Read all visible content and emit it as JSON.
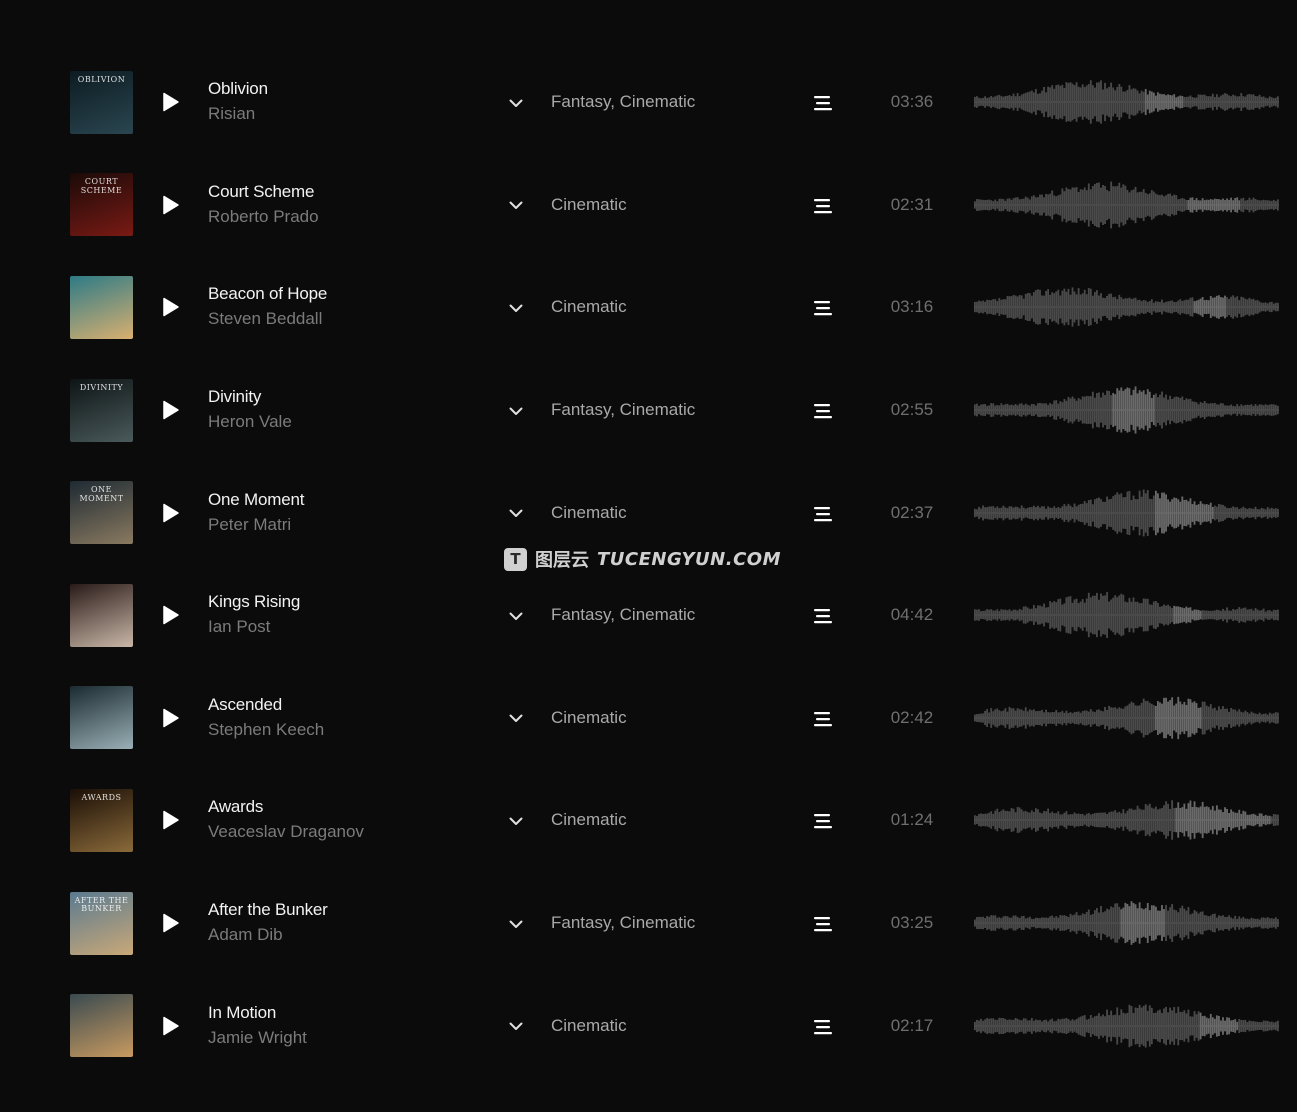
{
  "watermark": {
    "logo_letter": "T",
    "cn_text": "图层云",
    "en_text": "TUCENGYUN.COM"
  },
  "icons": {
    "play": "play-icon",
    "expand": "chevron-down-icon",
    "menu": "menu-lines-icon"
  },
  "colors": {
    "background": "#0b0b0b",
    "title": "#f2f2f2",
    "artist": "#7b7b7b",
    "genre": "#a9a9a9",
    "duration": "#6f6f6f",
    "waveform": "#4a4a4a",
    "waveform_played": "#6a6a6a"
  },
  "tracks": [
    {
      "title": "Oblivion",
      "artist": "Risian",
      "genres": "Fantasy, Cinematic",
      "duration": "03:36",
      "cover_text": "OBLIVION",
      "cover_colors": [
        "#0d1b22",
        "#2a4650"
      ],
      "seed": 11,
      "highlight": [
        0.56,
        0.68
      ]
    },
    {
      "title": "Court Scheme",
      "artist": "Roberto Prado",
      "genres": "Cinematic",
      "duration": "02:31",
      "cover_text": "COURT SCHEME",
      "cover_colors": [
        "#1a0a08",
        "#7a1a14"
      ],
      "seed": 23,
      "highlight": [
        0.7,
        0.87
      ]
    },
    {
      "title": "Beacon of Hope",
      "artist": "Steven Beddall",
      "genres": "Cinematic",
      "duration": "03:16",
      "cover_text": "",
      "cover_colors": [
        "#2d7a86",
        "#d9b070"
      ],
      "seed": 37,
      "highlight": [
        0.72,
        0.82
      ]
    },
    {
      "title": "Divinity",
      "artist": "Heron Vale",
      "genres": "Fantasy, Cinematic",
      "duration": "02:55",
      "cover_text": "DIVINITY",
      "cover_colors": [
        "#0e1416",
        "#4a5a5a"
      ],
      "seed": 41,
      "highlight": [
        0.45,
        0.59
      ]
    },
    {
      "title": "One Moment",
      "artist": "Peter Matri",
      "genres": "Cinematic",
      "duration": "02:37",
      "cover_text": "ONE MOMENT",
      "cover_colors": [
        "#1e2a33",
        "#8a7a60"
      ],
      "seed": 53,
      "highlight": [
        0.59,
        0.78
      ]
    },
    {
      "title": "Kings Rising",
      "artist": "Ian Post",
      "genres": "Fantasy, Cinematic",
      "duration": "04:42",
      "cover_text": "",
      "cover_colors": [
        "#2a1a18",
        "#c9b8a8"
      ],
      "seed": 67,
      "highlight": [
        0.65,
        0.74
      ]
    },
    {
      "title": "Ascended",
      "artist": "Stephen Keech",
      "genres": "Cinematic",
      "duration": "02:42",
      "cover_text": "",
      "cover_colors": [
        "#1a2a30",
        "#9ab0b6"
      ],
      "seed": 71,
      "highlight": [
        0.59,
        0.74
      ]
    },
    {
      "title": "Awards",
      "artist": "Veaceslav Draganov",
      "genres": "Cinematic",
      "duration": "01:24",
      "cover_text": "AWARDS",
      "cover_colors": [
        "#1a0e06",
        "#8a6a3a"
      ],
      "seed": 83,
      "highlight": [
        0.66,
        0.97
      ]
    },
    {
      "title": "After the Bunker",
      "artist": "Adam Dib",
      "genres": "Fantasy, Cinematic",
      "duration": "03:25",
      "cover_text": "After the Bunker",
      "cover_colors": [
        "#5a7a90",
        "#c9a878"
      ],
      "seed": 97,
      "highlight": [
        0.48,
        0.62
      ]
    },
    {
      "title": "In Motion",
      "artist": "Jamie Wright",
      "genres": "Cinematic",
      "duration": "02:17",
      "cover_text": "",
      "cover_colors": [
        "#3a4a50",
        "#c89a60"
      ],
      "seed": 103,
      "highlight": [
        0.74,
        0.86
      ]
    }
  ]
}
